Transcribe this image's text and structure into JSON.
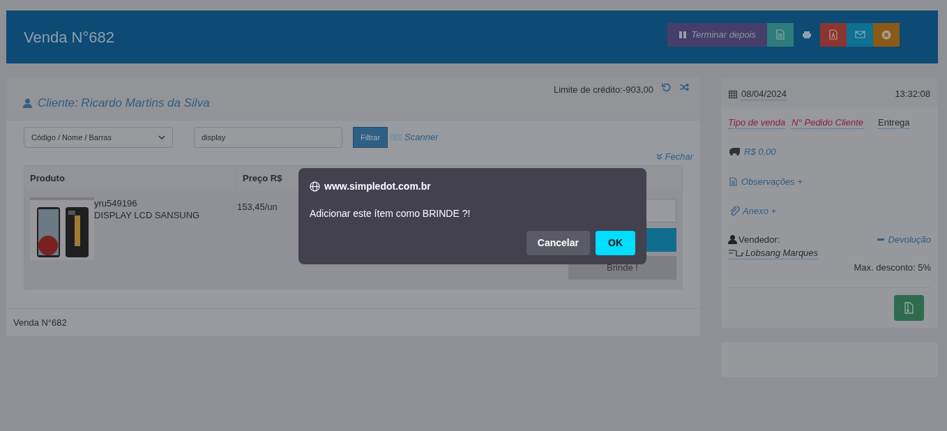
{
  "header": {
    "title": "Venda N°682",
    "actions": [
      {
        "kind": "later",
        "label": "Terminar depois",
        "color": "#453e69"
      },
      {
        "kind": "doc",
        "color": "#2e7b7b"
      },
      {
        "kind": "print",
        "color": "#0d4a74"
      },
      {
        "kind": "pdf",
        "color": "#8a3530"
      },
      {
        "kind": "mail",
        "color": "#0e7092"
      },
      {
        "kind": "cancel",
        "color": "#8a5a17"
      }
    ]
  },
  "client": {
    "label": "Cliente: Ricardo Martins da Silva",
    "credit": "Limite de crédito:-903,00"
  },
  "filter": {
    "select": "Código / Nome / Barras",
    "search": "display",
    "button": "Filtrar",
    "scanner": "Scanner",
    "close": "Fechar"
  },
  "table": {
    "columns": [
      "Produto",
      "Preço R$"
    ],
    "rows": [
      {
        "code": "yru549196",
        "name": "DISPLAY LCD SANSUNG",
        "price": "153,45/un",
        "gift_button": "Brinde !"
      }
    ]
  },
  "footer": "Venda N°682",
  "side": {
    "date": "08/04/2024",
    "time": "13:32:08",
    "links": [
      {
        "label": "Tipo de venda",
        "kind": "red"
      },
      {
        "label": "N° Pedido Cliente",
        "kind": "red"
      },
      {
        "label": "Entrega",
        "kind": "plain"
      }
    ],
    "freight": "R$ 0,00",
    "notes": "Observações +",
    "attachment": "Anexo +",
    "seller_label": "Vendedor:",
    "return": "Devolução",
    "seller": "Lobsang Marques",
    "discount": "Max. desconto: 5%"
  },
  "dialog": {
    "site": "www.simpledot.com.br",
    "message": "Adicionar este ítem como BRINDE ?!",
    "buttons": [
      {
        "label": "Cancelar",
        "kind": "secondary"
      },
      {
        "label": "OK",
        "kind": "primary"
      }
    ]
  }
}
